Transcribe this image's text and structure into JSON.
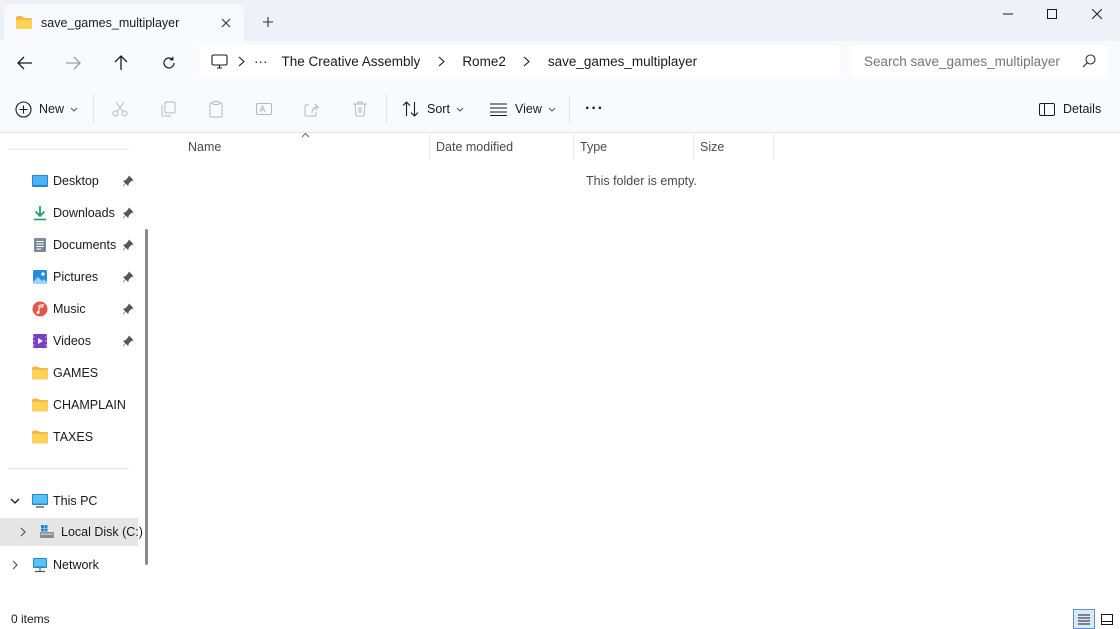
{
  "window": {
    "tab_title": "save_games_multiplayer",
    "controls": {
      "minimize": "minimize",
      "maximize": "maximize",
      "close": "close"
    }
  },
  "addressbar": {
    "overflow": "···",
    "crumbs": [
      "The Creative Assembly",
      "Rome2",
      "save_games_multiplayer"
    ]
  },
  "search": {
    "placeholder": "Search save_games_multiplayer"
  },
  "toolbar": {
    "new_label": "New",
    "sort_label": "Sort",
    "view_label": "View",
    "more_label": "···",
    "details_label": "Details"
  },
  "sidebar": {
    "quick_access": [
      {
        "label": "Desktop",
        "icon": "desktop-icon",
        "pinned": true
      },
      {
        "label": "Downloads",
        "icon": "downloads-icon",
        "pinned": true
      },
      {
        "label": "Documents",
        "icon": "documents-icon",
        "pinned": true
      },
      {
        "label": "Pictures",
        "icon": "pictures-icon",
        "pinned": true
      },
      {
        "label": "Music",
        "icon": "music-icon",
        "pinned": true
      },
      {
        "label": "Videos",
        "icon": "videos-icon",
        "pinned": true
      },
      {
        "label": "GAMES",
        "icon": "folder-icon",
        "pinned": false
      },
      {
        "label": "CHAMPLAIN",
        "icon": "folder-icon",
        "pinned": false
      },
      {
        "label": "TAXES",
        "icon": "folder-icon",
        "pinned": false
      }
    ],
    "this_pc": {
      "label": "This PC",
      "expanded": true
    },
    "local_disk": {
      "label": "Local Disk (C:)",
      "selected": true
    },
    "network": {
      "label": "Network"
    }
  },
  "columns": [
    "Name",
    "Date modified",
    "Type",
    "Size"
  ],
  "empty_message": "This folder is empty.",
  "status": {
    "items": "0 items"
  },
  "colors": {
    "accent": "#0067c0",
    "folder": "#f7c948",
    "titlebar_bg": "#eef1f8",
    "chrome_bg": "#f9fafd"
  }
}
